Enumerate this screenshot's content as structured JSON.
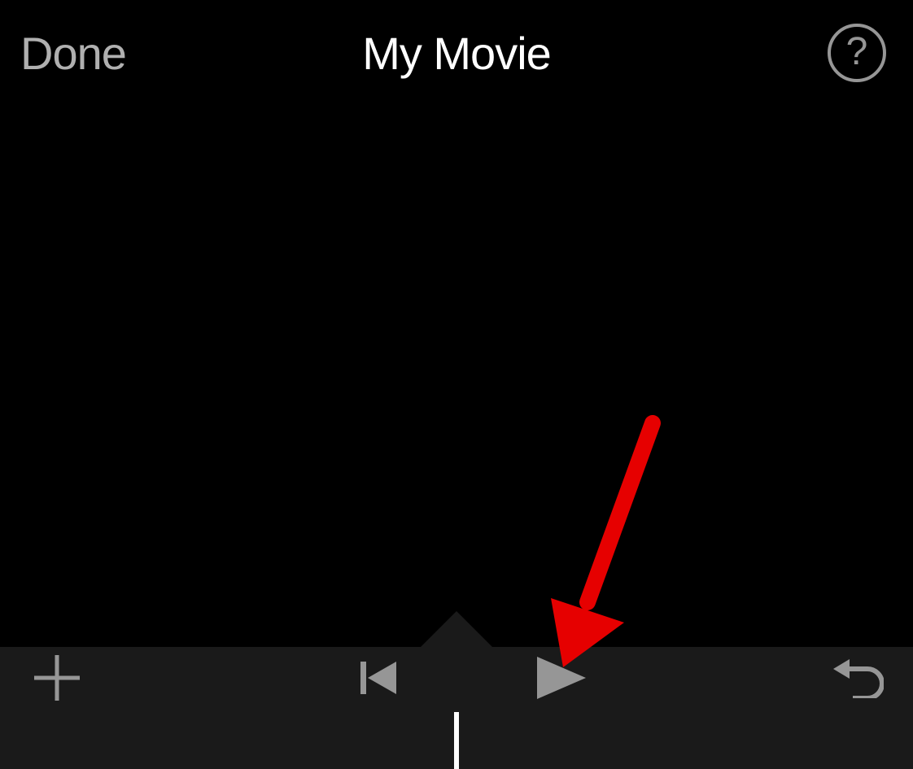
{
  "header": {
    "done_label": "Done",
    "title": "My Movie",
    "help_label": "?"
  },
  "icons": {
    "add": "plus-icon",
    "rewind": "skip-to-start-icon",
    "play": "play-icon",
    "undo": "undo-icon",
    "help": "help-icon"
  },
  "annotation": {
    "arrow_color": "#e60000",
    "arrow_target": "play-button"
  }
}
